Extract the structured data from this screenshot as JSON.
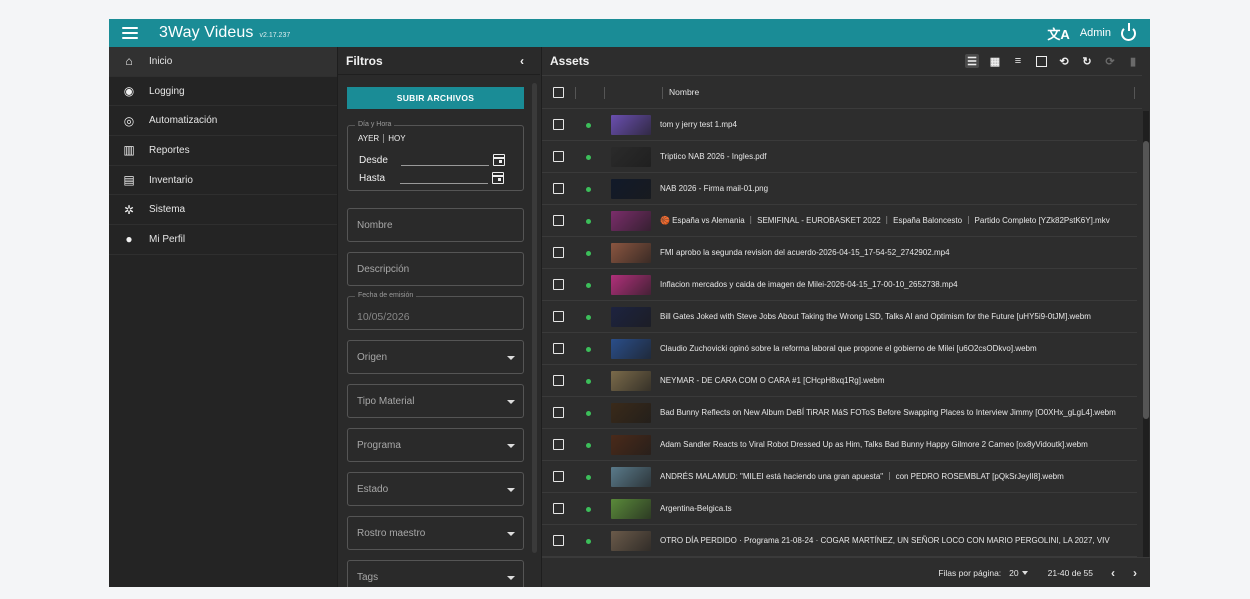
{
  "topbar": {
    "title": "3Way Videus",
    "version": "v2.17.237",
    "user": "Admin",
    "translate_icon": "translate-icon",
    "power_icon": "power-icon"
  },
  "sidebar": {
    "items": [
      {
        "label": "Inicio",
        "icon": "home-icon",
        "glyph": "⌂"
      },
      {
        "label": "Logging",
        "icon": "record-icon",
        "glyph": "◉"
      },
      {
        "label": "Automatización",
        "icon": "automation-icon",
        "glyph": "◎"
      },
      {
        "label": "Reportes",
        "icon": "reports-icon",
        "glyph": "▥"
      },
      {
        "label": "Inventario",
        "icon": "inventory-icon",
        "glyph": "▤"
      },
      {
        "label": "Sistema",
        "icon": "gear-icon",
        "glyph": "✲"
      },
      {
        "label": "Mi Perfil",
        "icon": "person-icon",
        "glyph": "●"
      }
    ]
  },
  "filters": {
    "title": "Filtros",
    "upload_label": "SUBIR ARCHIVOS",
    "datetime": {
      "legend": "Día y Hora",
      "yesterday": "AYER",
      "today": "HOY",
      "from": "Desde",
      "to": "Hasta"
    },
    "name_label": "Nombre",
    "description_label": "Descripción",
    "emission": {
      "legend": "Fecha de emisión",
      "value": "10/05/2026"
    },
    "selects": [
      "Origen",
      "Tipo Material",
      "Programa",
      "Estado",
      "Rostro maestro",
      "Tags"
    ]
  },
  "assets": {
    "title": "Assets",
    "column_name": "Nombre",
    "rows": [
      {
        "name": "tom y jerry test 1.mp4",
        "thumb": "#6a4fb0"
      },
      {
        "name": "Triptico NAB 2026 - Ingles.pdf",
        "thumb": "#2b2b2b"
      },
      {
        "name": "NAB 2026 - Firma mail-01.png",
        "thumb": "#111a2a"
      },
      {
        "name": "🏀 España vs Alemania ｜ SEMIFINAL - EUROBASKET 2022 ｜ España Baloncesto ｜ Partido Completo [YZk82PstK6Y].mkv",
        "thumb": "#7a2d6a"
      },
      {
        "name": "FMI aprobo la segunda revision del acuerdo-2026-04-15_17-54-52_2742902.mp4",
        "thumb": "#8a5540"
      },
      {
        "name": "Inflacion mercados y caida de imagen de Milei-2026-04-15_17-00-10_2652738.mp4",
        "thumb": "#b0307a"
      },
      {
        "name": "Bill Gates Joked with Steve Jobs About Taking the Wrong LSD, Talks AI and Optimism for the Future [uHY5i9-0tJM].webm",
        "thumb": "#1d2340"
      },
      {
        "name": "Claudio Zuchovicki opinó sobre la reforma laboral que propone el gobierno de Milei [u6O2csODkvo].webm",
        "thumb": "#2a4e8a"
      },
      {
        "name": "NEYMAR - DE CARA COM O CARA #1 [CHcpH8xq1Rg].webm",
        "thumb": "#7a6a4a"
      },
      {
        "name": "Bad Bunny Reflects on New Album DeBÍ TiRAR MáS FOToS Before Swapping Places to Interview Jimmy [O0XHx_gLgL4].webm",
        "thumb": "#3a2a1a"
      },
      {
        "name": "Adam Sandler Reacts to Viral Robot Dressed Up as Him, Talks Bad Bunny Happy Gilmore 2 Cameo [ox8yVidoutk].webm",
        "thumb": "#4a2a1a"
      },
      {
        "name": "ANDRÉS MALAMUD:  \"MILEI está haciendo una gran apuesta\" ｜ con PEDRO ROSEMBLAT [pQkSrJeyIl8].webm",
        "thumb": "#5a7a8a"
      },
      {
        "name": "Argentina-Belgica.ts",
        "thumb": "#5a8a3a"
      },
      {
        "name": "OTRO DÍA PERDIDO · Programa 21-08-24 · COGAR MARTÍNEZ, UN SEÑOR LOCO CON MARIO PERGOLINI, LA 2027, VIV",
        "thumb": "#6a5a4a"
      }
    ],
    "footer": {
      "rows_per_page_label": "Filas por página:",
      "rows_per_page": "20",
      "range": "21-40 de 55"
    }
  }
}
